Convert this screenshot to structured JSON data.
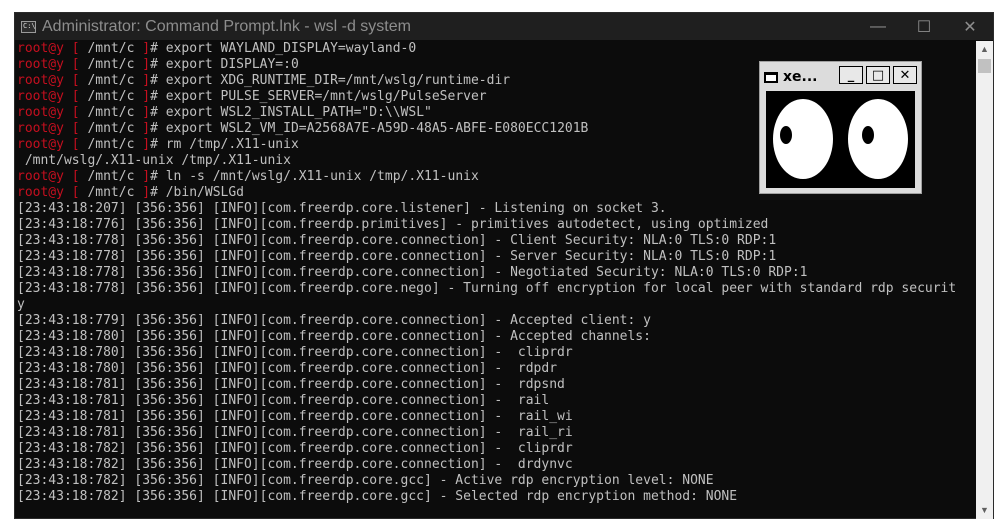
{
  "window": {
    "title": "Administrator: Command Prompt.lnk - wsl  -d system",
    "icon": "cmd-icon",
    "controls": {
      "minimize": "—",
      "maximize": "☐",
      "close": "✕"
    }
  },
  "console": {
    "prompt_user": "root@y",
    "prompt_dir": " [ /mnt/c ]",
    "prompt_symbol": "# ",
    "lines": [
      {
        "prompt": true,
        "text": "export WAYLAND_DISPLAY=wayland-0"
      },
      {
        "prompt": true,
        "text": "export DISPLAY=:0"
      },
      {
        "prompt": true,
        "text": "export XDG_RUNTIME_DIR=/mnt/wslg/runtime-dir"
      },
      {
        "prompt": true,
        "text": "export PULSE_SERVER=/mnt/wslg/PulseServer"
      },
      {
        "prompt": true,
        "text": "export WSL2_INSTALL_PATH=\"D:\\\\WSL\""
      },
      {
        "prompt": true,
        "text": "export WSL2_VM_ID=A2568A7E-A59D-48A5-ABFE-E080ECC1201B"
      },
      {
        "prompt": true,
        "text": "rm /tmp/.X11-unix"
      },
      {
        "prompt": false,
        "text": " /mnt/wslg/.X11-unix /tmp/.X11-unix"
      },
      {
        "prompt": true,
        "text": "ln -s /mnt/wslg/.X11-unix /tmp/.X11-unix"
      },
      {
        "prompt": true,
        "text": "/bin/WSLGd"
      },
      {
        "prompt": false,
        "text": "[23:43:18:207] [356:356] [INFO][com.freerdp.core.listener] - Listening on socket 3."
      },
      {
        "prompt": false,
        "text": "[23:43:18:776] [356:356] [INFO][com.freerdp.primitives] - primitives autodetect, using optimized"
      },
      {
        "prompt": false,
        "text": "[23:43:18:778] [356:356] [INFO][com.freerdp.core.connection] - Client Security: NLA:0 TLS:0 RDP:1"
      },
      {
        "prompt": false,
        "text": "[23:43:18:778] [356:356] [INFO][com.freerdp.core.connection] - Server Security: NLA:0 TLS:0 RDP:1"
      },
      {
        "prompt": false,
        "text": "[23:43:18:778] [356:356] [INFO][com.freerdp.core.connection] - Negotiated Security: NLA:0 TLS:0 RDP:1"
      },
      {
        "prompt": false,
        "text": "[23:43:18:778] [356:356] [INFO][com.freerdp.core.nego] - Turning off encryption for local peer with standard rdp securit"
      },
      {
        "prompt": false,
        "text": "y"
      },
      {
        "prompt": false,
        "text": "[23:43:18:779] [356:356] [INFO][com.freerdp.core.connection] - Accepted client: y"
      },
      {
        "prompt": false,
        "text": "[23:43:18:780] [356:356] [INFO][com.freerdp.core.connection] - Accepted channels:"
      },
      {
        "prompt": false,
        "text": "[23:43:18:780] [356:356] [INFO][com.freerdp.core.connection] -  cliprdr"
      },
      {
        "prompt": false,
        "text": "[23:43:18:780] [356:356] [INFO][com.freerdp.core.connection] -  rdpdr"
      },
      {
        "prompt": false,
        "text": "[23:43:18:781] [356:356] [INFO][com.freerdp.core.connection] -  rdpsnd"
      },
      {
        "prompt": false,
        "text": "[23:43:18:781] [356:356] [INFO][com.freerdp.core.connection] -  rail"
      },
      {
        "prompt": false,
        "text": "[23:43:18:781] [356:356] [INFO][com.freerdp.core.connection] -  rail_wi"
      },
      {
        "prompt": false,
        "text": "[23:43:18:781] [356:356] [INFO][com.freerdp.core.connection] -  rail_ri"
      },
      {
        "prompt": false,
        "text": "[23:43:18:782] [356:356] [INFO][com.freerdp.core.connection] -  cliprdr"
      },
      {
        "prompt": false,
        "text": "[23:43:18:782] [356:356] [INFO][com.freerdp.core.connection] -  drdynvc"
      },
      {
        "prompt": false,
        "text": "[23:43:18:782] [356:356] [INFO][com.freerdp.core.gcc] - Active rdp encryption level: NONE"
      },
      {
        "prompt": false,
        "text": "[23:43:18:782] [356:356] [INFO][com.freerdp.core.gcc] - Selected rdp encryption method: NONE"
      }
    ]
  },
  "xeyes": {
    "title": "xe...",
    "buttons": {
      "minimize": "_",
      "maximize": "□",
      "close": "✕"
    }
  },
  "colors": {
    "prompt_user": "#c50f1f",
    "text": "#c0c0c0",
    "background": "#0c0c0c"
  }
}
